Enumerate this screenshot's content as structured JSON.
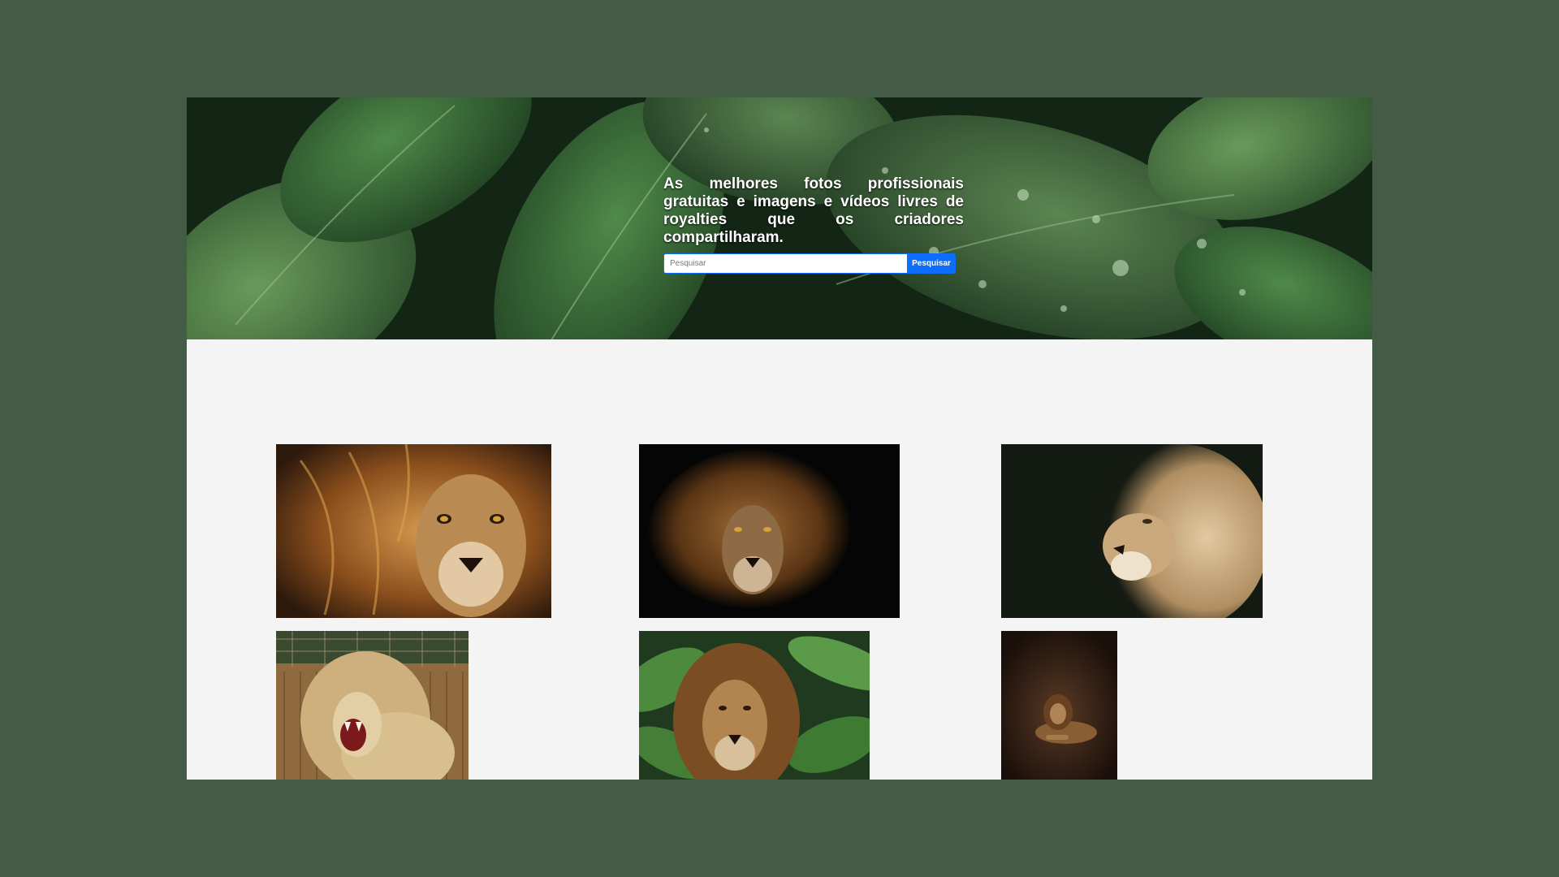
{
  "hero": {
    "title": "As melhores fotos profissionais gratuitas e imagens e vídeos livres de royalties que os criadores compartilharam.",
    "search": {
      "placeholder": "Pesquisar",
      "value": "",
      "button_label": "Pesquisar"
    },
    "background": "green-leaves-with-water-drops"
  },
  "gallery": {
    "photos": [
      {
        "subject": "lion-closeup-golden-mane"
      },
      {
        "subject": "lion-dark-background"
      },
      {
        "subject": "lion-profile-light-mane"
      },
      {
        "subject": "lion-roaring-at-fence"
      },
      {
        "subject": "lion-in-jungle-foliage"
      },
      {
        "subject": "lion-lying-on-ground"
      }
    ]
  },
  "colors": {
    "page_background": "#445c46",
    "content_background": "#f4f4f4",
    "accent": "#0d6efd"
  }
}
